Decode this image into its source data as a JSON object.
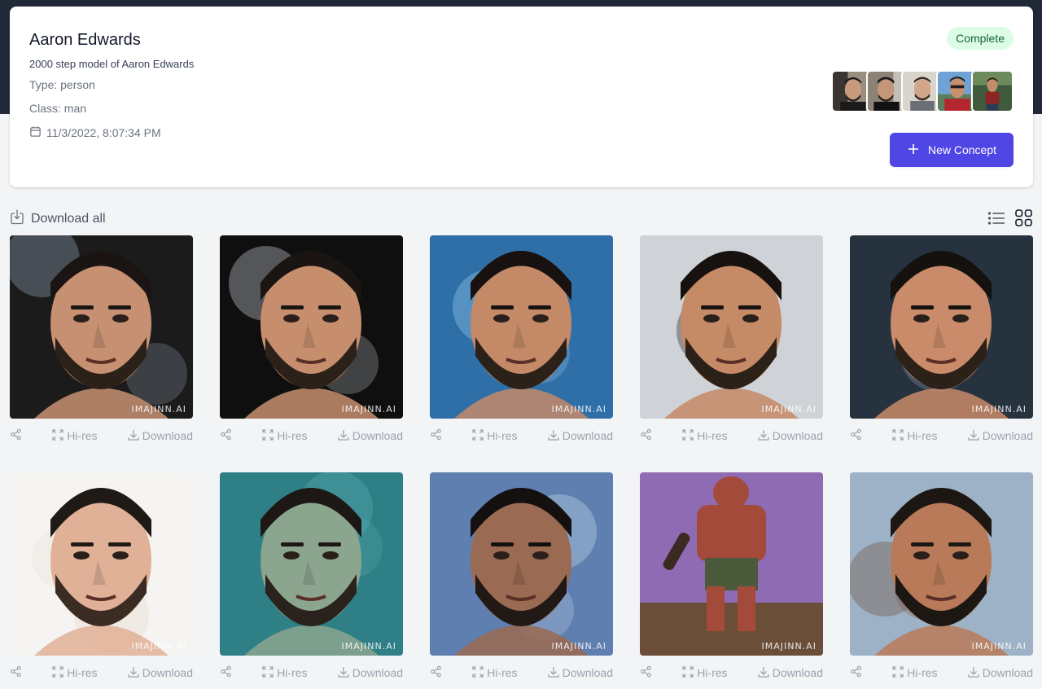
{
  "model": {
    "name": "Aaron Edwards",
    "description": "2000 step model of Aaron Edwards",
    "type": "Type: person",
    "class": "Class: man",
    "created": "11/3/2022, 8:07:34 PM",
    "status": "Complete"
  },
  "actions": {
    "new_concept": "New Concept",
    "download_all": "Download all"
  },
  "tile_actions": {
    "hires": "Hi-res",
    "download": "Download",
    "watermark": "IMAJINN.AI"
  },
  "colors": {
    "accent": "#4f46e5",
    "status_bg": "#dcfce7",
    "status_text": "#166534",
    "header_band": "#1f2937"
  },
  "icons": [
    "calendar-icon",
    "plus-icon",
    "download-all-icon",
    "list-view-icon",
    "grid-view-icon",
    "share-icon",
    "expand-icon",
    "download-icon"
  ]
}
